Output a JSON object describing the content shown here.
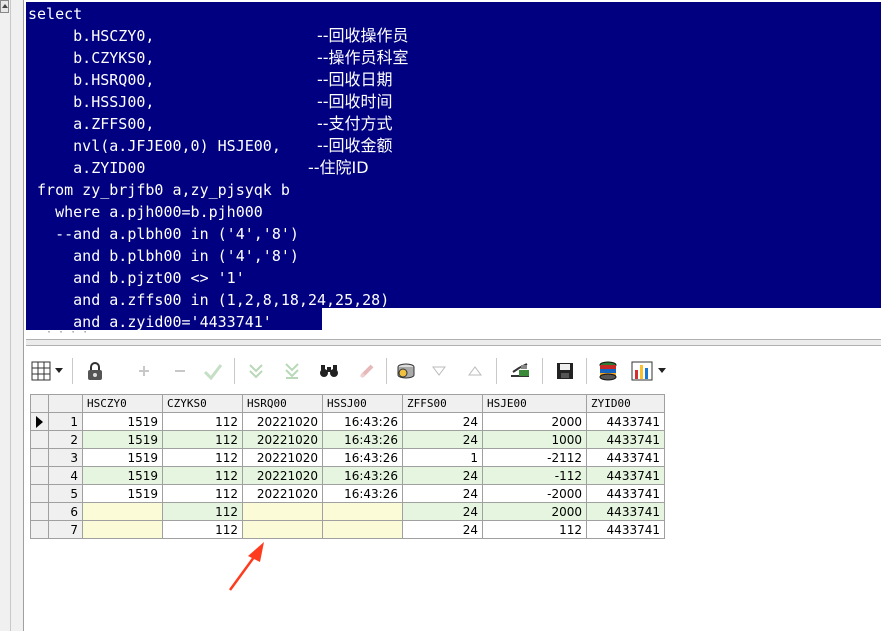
{
  "editor": {
    "lines": [
      {
        "code": "select",
        "comment": ""
      },
      {
        "code": "     b.HSCZY0,                  ",
        "comment": "--回收操作员"
      },
      {
        "code": "     b.CZYKS0,                  ",
        "comment": "--操作员科室"
      },
      {
        "code": "     b.HSRQ00,                  ",
        "comment": "--回收日期"
      },
      {
        "code": "     b.HSSJ00,                  ",
        "comment": "--回收时间"
      },
      {
        "code": "     a.ZFFS00,                  ",
        "comment": "--支付方式"
      },
      {
        "code": "     nvl(a.JFJE00,0) HSJE00,    ",
        "comment": "--回收金额"
      },
      {
        "code": "     a.ZYID00                  ",
        "comment": "--住院ID"
      },
      {
        "code": " from zy_brjfb0 a,zy_pjsyqk b",
        "comment": ""
      },
      {
        "code": "   where a.pjh000=b.pjh000",
        "comment": ""
      },
      {
        "code": "   --and a.plbh00 in ('4','8')",
        "comment": ""
      },
      {
        "code": "     and b.plbh00 in ('4','8')",
        "comment": ""
      },
      {
        "code": "     and b.pjzt00 <> '1'",
        "comment": ""
      },
      {
        "code": "     and a.zffs00 in (1,2,8,18,24,25,28)",
        "comment": ""
      },
      {
        "code": "     and a.zyid00='4433741'",
        "comment": ""
      }
    ]
  },
  "toolbar": {
    "icons": [
      "grid-view-icon",
      "dropdown-icon",
      "lock-icon",
      "add-record-icon",
      "delete-record-icon",
      "post-record-icon",
      "next-record-icon",
      "last-record-icon",
      "find-icon",
      "clear-icon",
      "query-icon",
      "filter-down-icon",
      "filter-up-icon",
      "export-icon",
      "save-icon",
      "database-icon",
      "chart-icon",
      "chart-dropdown-icon"
    ]
  },
  "grid": {
    "columns": [
      "HSCZY0",
      "CZYKS0",
      "HSRQ00",
      "HSSJ00",
      "ZFFS00",
      "HSJE00",
      "ZYID00"
    ],
    "rows": [
      {
        "num": "1",
        "cells": [
          "1519",
          "112",
          "20221020",
          "16:43:26",
          "24",
          "2000",
          "4433741"
        ]
      },
      {
        "num": "2",
        "cells": [
          "1519",
          "112",
          "20221020",
          "16:43:26",
          "24",
          "1000",
          "4433741"
        ]
      },
      {
        "num": "3",
        "cells": [
          "1519",
          "112",
          "20221020",
          "16:43:26",
          "1",
          "-2112",
          "4433741"
        ]
      },
      {
        "num": "4",
        "cells": [
          "1519",
          "112",
          "20221020",
          "16:43:26",
          "24",
          "-112",
          "4433741"
        ]
      },
      {
        "num": "5",
        "cells": [
          "1519",
          "112",
          "20221020",
          "16:43:26",
          "24",
          "-2000",
          "4433741"
        ]
      },
      {
        "num": "6",
        "cells": [
          "",
          "112",
          "",
          "",
          "24",
          "2000",
          "4433741"
        ]
      },
      {
        "num": "7",
        "cells": [
          "",
          "112",
          "",
          "",
          "24",
          "112",
          "4433741"
        ]
      }
    ],
    "current_row": 0
  },
  "colors": {
    "selection": "#000080",
    "even_row": "#e6f5e0",
    "null_cell": "#fbfbd8",
    "annotation_arrow": "#ff3b1f"
  }
}
